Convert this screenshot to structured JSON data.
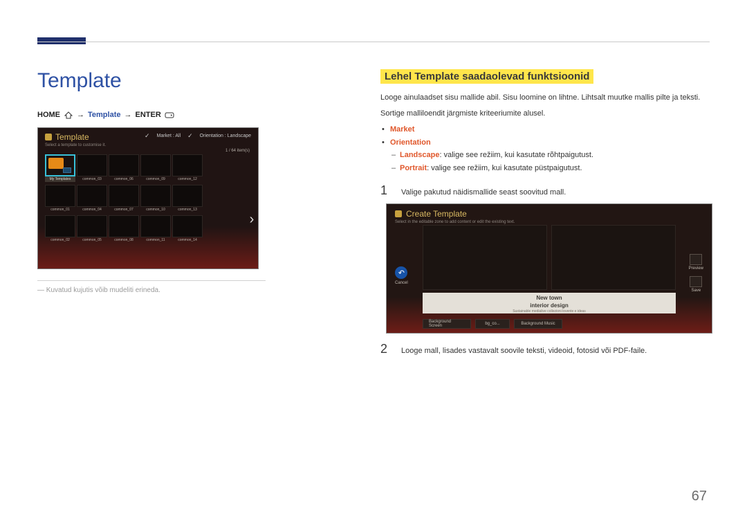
{
  "page_number": "67",
  "left": {
    "heading": "Template",
    "breadcrumb": {
      "home": "HOME",
      "template": "Template",
      "enter": "ENTER"
    },
    "screen": {
      "title": "Template",
      "subtitle": "Select a template to customise it.",
      "filter_market": "Market : All",
      "filter_orient": "Orientation : Landscape",
      "count": "1 / 64 item(s)",
      "first_thumb": "My Templates",
      "thumbs": [
        "My Templates",
        "common_03",
        "common_06",
        "common_09",
        "common_12",
        "common_01",
        "common_04",
        "common_07",
        "common_10",
        "common_13",
        "common_02",
        "common_05",
        "common_08",
        "common_11",
        "common_14"
      ]
    },
    "note": "Kuvatud kujutis võib mudeliti erineda."
  },
  "right": {
    "title": "Lehel Template saadaolevad funktsioonid",
    "p1": "Looge ainulaadset sisu mallide abil. Sisu loomine on lihtne. Lihtsalt muutke mallis pilte ja teksti.",
    "p2": "Sortige malliloendit järgmiste kriteeriumite alusel.",
    "b1": "Market",
    "b2": "Orientation",
    "b2a_term": "Landscape",
    "b2a_rest": ": valige see režiim, kui kasutate rõhtpaigutust.",
    "b2b_term": "Portrait",
    "b2b_rest": ": valige see režiim, kui kasutate püstpaigutust.",
    "step1_num": "1",
    "step1_text": "Valige pakutud näidismallide seast soovitud mall.",
    "screen2": {
      "title": "Create Template",
      "subtitle": "Select in the editable zone to add content or edit the existing text.",
      "cancel": "Cancel",
      "preview": "Preview",
      "save": "Save",
      "text1": "New town",
      "text2": "interior design",
      "text3": "Sustainable medialive collezioni lovente e ideas",
      "tab1": "Background Screen",
      "tab2": "bg_co...",
      "tab3": "Background Music"
    },
    "step2_num": "2",
    "step2_text": "Looge mall, lisades vastavalt soovile teksti, videoid, fotosid või PDF-faile."
  }
}
